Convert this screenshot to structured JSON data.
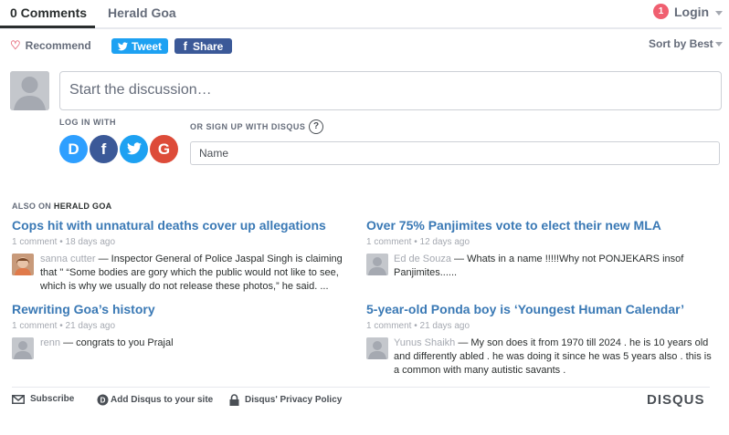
{
  "header": {
    "comments_tab": "0 Comments",
    "site_tab": "Herald Goa",
    "login_badge": "1",
    "login_label": "Login"
  },
  "actions": {
    "recommend_label": "Recommend",
    "tweet_label": "Tweet",
    "share_label": "Share",
    "sort_label": "Sort by Best"
  },
  "composer": {
    "placeholder": "Start the discussion…",
    "login_with_label": "LOG IN WITH",
    "signup_label": "OR SIGN UP WITH DISQUS",
    "help_glyph": "?",
    "social": [
      {
        "glyph": "D",
        "color": "#2e9fff"
      },
      {
        "glyph": "f",
        "color": "#3b5998"
      },
      {
        "glyph": "t",
        "color": "#1da1f2"
      },
      {
        "glyph": "G",
        "color": "#dd4b39"
      }
    ],
    "name_placeholder": "Name"
  },
  "also_on": {
    "prefix": "ALSO ON",
    "site": "HERALD GOA",
    "articles": [
      {
        "title": "Cops hit with unnatural deaths cover up allegations",
        "meta": "1 comment • 18 days ago",
        "author": "sanna cutter",
        "text": " — Inspector General of Police Jaspal Singh is claiming that \" “Some bodies are gory which the public would not like to see, which is why we usually do not release these photos,” he said. ..."
      },
      {
        "title": "Over 75% Panjimites vote to elect their new MLA",
        "meta": "1 comment • 12 days ago",
        "author": "Ed de Souza",
        "text": " — Whats in a name !!!!!Why not PONJEKARS insof Panjimites......"
      },
      {
        "title": "Rewriting Goa’s history",
        "meta": "1 comment • 21 days ago",
        "author": "renn",
        "text": " — congrats to you Prajal"
      },
      {
        "title": "5-year-old Ponda boy is ‘Youngest Human Calendar’",
        "meta": "1 comment • 21 days ago",
        "author": "Yunus Shaikh",
        "text": " — My son does it from 1970 till 2024 . he is 10 years old and differently abled . he was doing it since he was 5 years also . this is a common with many autistic savants ."
      }
    ]
  },
  "footer": {
    "subscribe": "Subscribe",
    "add_disqus": "Add Disqus to your site",
    "privacy": "Disqus' Privacy Policy",
    "logo": "DISQUS"
  },
  "colors": {
    "accent": "#2e9fff",
    "link": "#3a79b5",
    "badge": "#f05f70"
  }
}
